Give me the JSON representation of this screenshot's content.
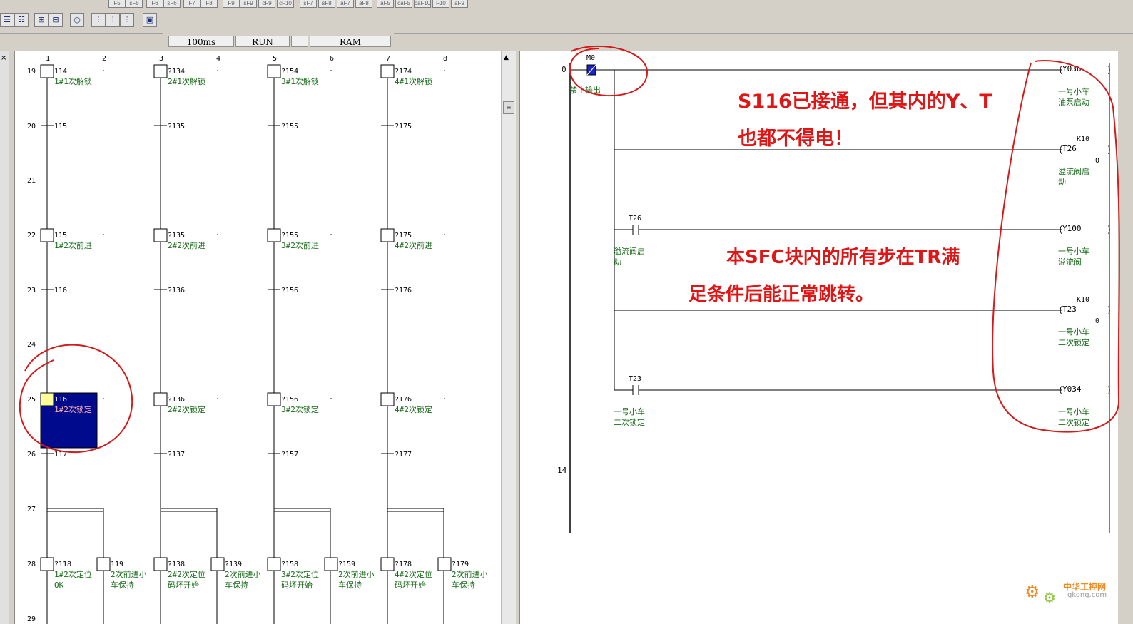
{
  "toolbar": {
    "fkeys": [
      "F5",
      "sF5",
      "F6",
      "sF6",
      "F7",
      "F8",
      "F9",
      "sF9",
      "cF9",
      "cF10",
      "sF7",
      "sF8",
      "aF7",
      "aF8",
      "aF5",
      "caF5",
      "caF10",
      "F10",
      "aF9"
    ]
  },
  "status": {
    "scan_time": "100ms",
    "mode": "RUN",
    "memory": "RAM"
  },
  "sfc": {
    "col_headers": [
      "1",
      "2",
      "3",
      "4",
      "5",
      "6",
      "7",
      "8"
    ],
    "row_numbers": [
      "19",
      "20",
      "21",
      "22",
      "23",
      "24",
      "25",
      "26",
      "27",
      "28",
      "29"
    ],
    "steps": [
      {
        "num": "114",
        "label": "1#1次解锁"
      },
      {
        "num": "?134",
        "label": "2#1次解锁"
      },
      {
        "num": "?154",
        "label": "3#1次解锁"
      },
      {
        "num": "?174",
        "label": "4#1次解锁"
      },
      {
        "num": "115",
        "label": "1#2次前进"
      },
      {
        "num": "?135",
        "label": "2#2次前进"
      },
      {
        "num": "?155",
        "label": "3#2次前进"
      },
      {
        "num": "?175",
        "label": "4#2次前进"
      },
      {
        "num": "116",
        "label": "1#2次锁定"
      },
      {
        "num": "?136",
        "label": "2#2次锁定"
      },
      {
        "num": "?156",
        "label": "3#2次锁定"
      },
      {
        "num": "?176",
        "label": "4#2次锁定"
      }
    ],
    "transitions": [
      {
        "num": "115"
      },
      {
        "num": "?135"
      },
      {
        "num": "?155"
      },
      {
        "num": "?175"
      },
      {
        "num": "116"
      },
      {
        "num": "?136"
      },
      {
        "num": "?156"
      },
      {
        "num": "?176"
      },
      {
        "num": "117"
      },
      {
        "num": "?137"
      },
      {
        "num": "?157"
      },
      {
        "num": "?177"
      }
    ],
    "branch_steps": [
      {
        "num": "?118",
        "label1": "1#2次定位",
        "label2": "OK"
      },
      {
        "num": "119",
        "label1": "2次前进小",
        "label2": "车保持"
      },
      {
        "num": "?138",
        "label1": "2#2次定位",
        "label2": "码坯开始"
      },
      {
        "num": "?139",
        "label1": "2次前进小",
        "label2": "车保持"
      },
      {
        "num": "?158",
        "label1": "3#2次定位",
        "label2": "码坯开始"
      },
      {
        "num": "?159",
        "label1": "2次前进小",
        "label2": "车保持"
      },
      {
        "num": "?178",
        "label1": "4#2次定位",
        "label2": "码坯开始"
      },
      {
        "num": "?179",
        "label1": "2次前进小",
        "label2": "车保持"
      }
    ]
  },
  "ladder": {
    "step_numbers": [
      "0",
      "14"
    ],
    "m0_label": "M0",
    "m0_comment": "禁止输出",
    "t26_contact": "T26",
    "t26_comment1": "溢流阀启",
    "t26_comment2": "动",
    "t23_contact": "T23",
    "t23_comment1": "一号小车",
    "t23_comment2": "二次锁定",
    "coils": [
      {
        "name": "Y036",
        "k": "",
        "k0": "",
        "comment1": "一号小车",
        "comment2": "油泵启动"
      },
      {
        "name": "T26",
        "k": "K10",
        "k0": "0",
        "comment1": "溢流阀启",
        "comment2": "动"
      },
      {
        "name": "Y100",
        "k": "",
        "k0": "",
        "comment1": "一号小车",
        "comment2": "溢流阀"
      },
      {
        "name": "T23",
        "k": "K10",
        "k0": "0",
        "comment1": "一号小车",
        "comment2": "二次锁定"
      },
      {
        "name": "Y034",
        "k": "",
        "k0": "",
        "comment1": "一号小车",
        "comment2": "二次锁定"
      }
    ]
  },
  "annotations": {
    "note1_line1": "S116已接通，但其内的Y、T",
    "note1_line2": "也都不得电！",
    "note2_line1": "本SFC块内的所有步在TR满",
    "note2_line2": "足条件后能正常跳转。"
  },
  "colors": {
    "step_text": "#1a6b1a",
    "active_block": "#000a8c",
    "annotation": "#e01515"
  },
  "watermark": {
    "text1": "中华工控网",
    "text2": "gkong.com"
  }
}
